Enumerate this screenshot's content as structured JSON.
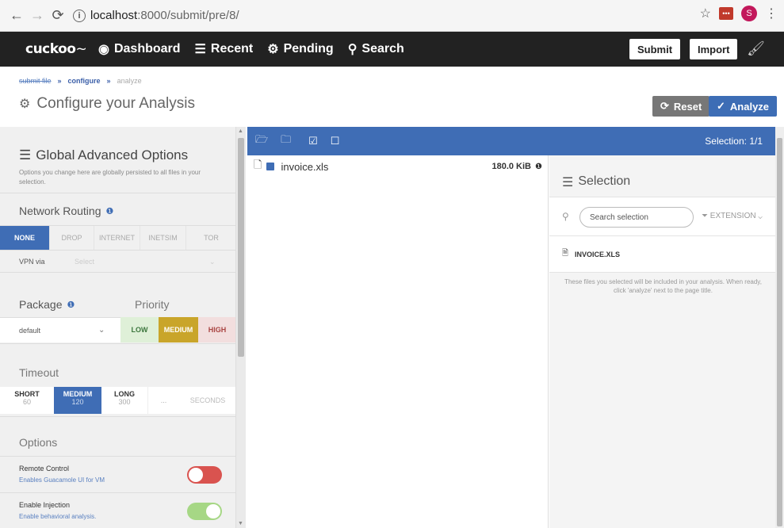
{
  "browser": {
    "url_host": "localhost",
    "url_rest": ":8000/submit/pre/8/",
    "profile_initial": "S"
  },
  "nav": {
    "logo": "cuckoo",
    "items": [
      "Dashboard",
      "Recent",
      "Pending",
      "Search"
    ],
    "submit": "Submit",
    "import": "Import"
  },
  "breadcrumb": [
    "submit file",
    "configure",
    "analyze"
  ],
  "page_title": "Configure your Analysis",
  "actions": {
    "reset": "Reset",
    "analyze": "Analyze"
  },
  "global": {
    "title": "Global Advanced Options",
    "desc": "Options you change here are globally persisted to all files in your selection.",
    "routing_label": "Network Routing",
    "routing": [
      "NONE",
      "DROP",
      "INTERNET",
      "INETSIM",
      "TOR"
    ],
    "vpn_label": "VPN via",
    "vpn_placeholder": "Select",
    "package_label": "Package",
    "priority_label": "Priority",
    "package_value": "default",
    "priority": [
      "LOW",
      "MEDIUM",
      "HIGH"
    ],
    "timeout_label": "Timeout",
    "timeout": [
      {
        "label": "SHORT",
        "value": "60"
      },
      {
        "label": "MEDIUM",
        "value": "120"
      },
      {
        "label": "LONG",
        "value": "300"
      }
    ],
    "timeout_custom": "...",
    "timeout_unit": "SECONDS",
    "options_label": "Options",
    "remote_control": {
      "label": "Remote Control",
      "desc": "Enables Guacamole UI for VM",
      "on": false
    },
    "injection": {
      "label": "Enable Injection",
      "desc": "Enable behavioral analysis.",
      "on": true
    }
  },
  "files": {
    "selection_count": "Selection: 1/1",
    "items": [
      {
        "name": "invoice.xls",
        "size": "180.0 KiB"
      }
    ]
  },
  "selection": {
    "title": "Selection",
    "search_placeholder": "Search selection",
    "filter": "EXTENSION",
    "items": [
      "INVOICE.XLS"
    ],
    "note": "These files you selected will be included in your analysis. When ready, click 'analyze' next to the page title."
  },
  "colors": {
    "accent": "#3f6db5",
    "navbar": "#222222",
    "low": "#dff0d8",
    "medium": "#c9a52a",
    "high": "#f2dede",
    "toggle_off": "#d9534f",
    "toggle_on": "#a6d785"
  }
}
